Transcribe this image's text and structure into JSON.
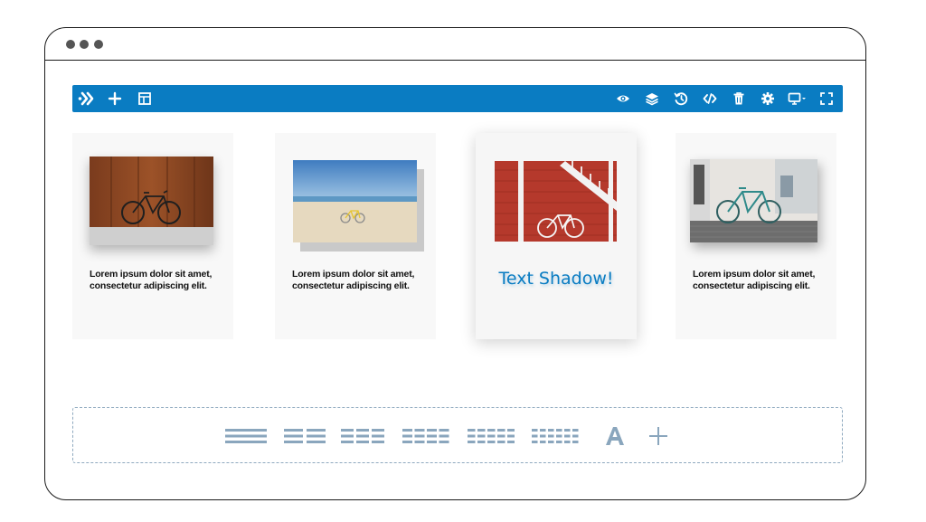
{
  "window": {
    "controls": [
      "close",
      "minimize",
      "maximize"
    ]
  },
  "toolbar": {
    "color": "#0a7cc2",
    "left_icons": [
      "logo-icon",
      "add-icon",
      "template-icon"
    ],
    "right_icons": [
      "eye-icon",
      "layers-icon",
      "history-icon",
      "code-icon",
      "trash-icon",
      "gear-icon",
      "desktop-icon",
      "fullscreen-icon"
    ]
  },
  "cards": [
    {
      "photo": "bike-rust-wall",
      "text": "Lorem ipsum dolor sit amet, consectetur adipiscing elit."
    },
    {
      "photo": "bike-beach",
      "text": "Lorem ipsum dolor sit amet, consectetur adipiscing elit."
    },
    {
      "photo": "bike-red-stairs",
      "heading": "Text Shadow!",
      "active": true
    },
    {
      "photo": "bike-white-wall",
      "text": "Lorem ipsum dolor sit amet, consectetur adipiscing elit."
    }
  ],
  "layout_picker": {
    "options": [
      "one-column-icon",
      "two-column-icon",
      "three-column-icon",
      "four-column-icon",
      "five-column-icon",
      "six-column-icon",
      "text-icon",
      "add-icon"
    ],
    "color": "#8aa6bd"
  }
}
